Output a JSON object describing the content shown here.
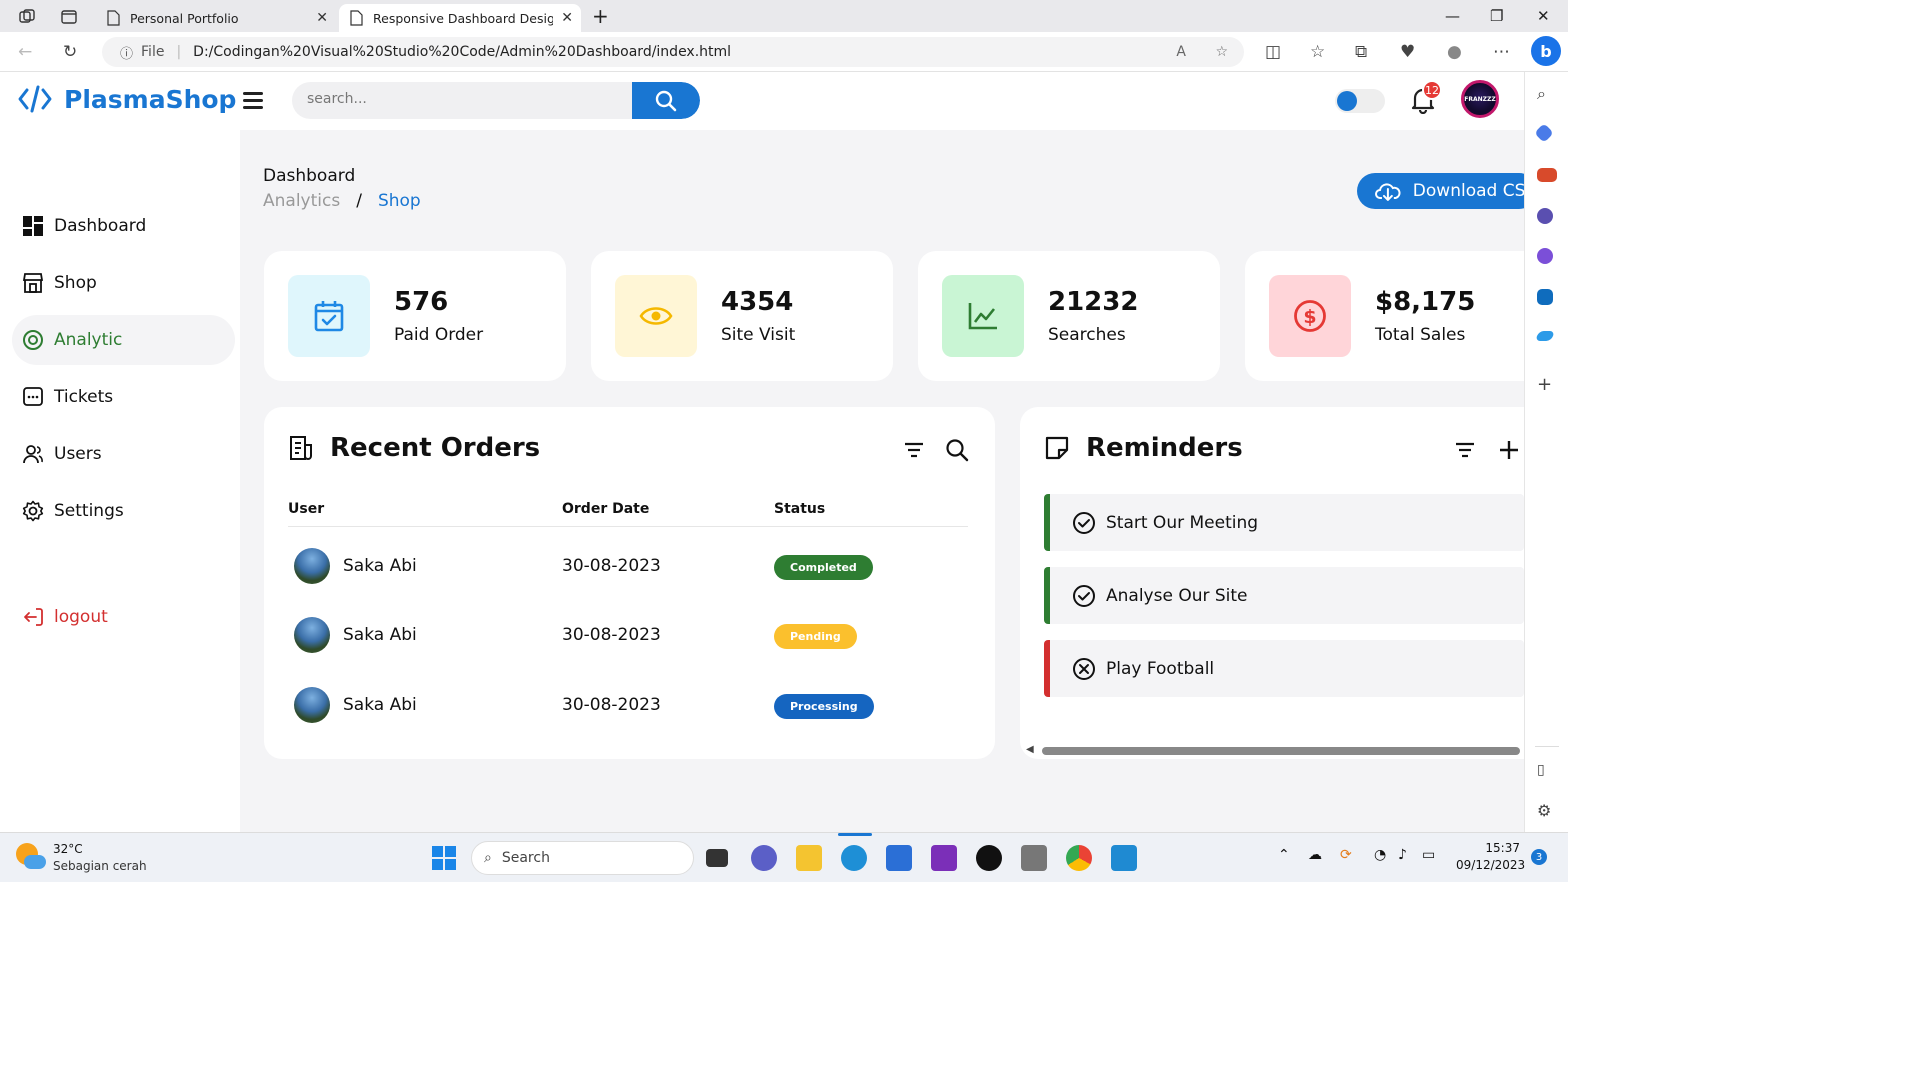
{
  "browser": {
    "tabs": [
      {
        "title": "Personal Portfolio"
      },
      {
        "title": "Responsive Dashboard Design By"
      }
    ],
    "address_prefix": "File",
    "address": "D:/Codingan%20Visual%20Studio%20Code/Admin%20Dashboard/index.html"
  },
  "app": {
    "brand": "PlasmaShop",
    "search_placeholder": "search...",
    "notifications_count": "12",
    "avatar_text": "FRANZZZ"
  },
  "sidebar": {
    "items": [
      {
        "label": "Dashboard"
      },
      {
        "label": "Shop"
      },
      {
        "label": "Analytic"
      },
      {
        "label": "Tickets"
      },
      {
        "label": "Users"
      },
      {
        "label": "Settings"
      }
    ],
    "logout_label": "logout"
  },
  "main": {
    "title": "Dashboard",
    "breadcrumb": {
      "first": "Analytics",
      "sep": "/",
      "current": "Shop"
    },
    "download_label": "Download CSV",
    "cards": [
      {
        "value": "576",
        "label": "Paid Order",
        "color": "#dff6fc",
        "icon_color": "#1e88e5"
      },
      {
        "value": "4354",
        "label": "Site Visit",
        "color": "#fff6d6",
        "icon_color": "#f5b800"
      },
      {
        "value": "21232",
        "label": "Searches",
        "color": "#c9f5d4",
        "icon_color": "#2e7d32"
      },
      {
        "value": "$8,175",
        "label": "Total Sales",
        "color": "#ffd5d9",
        "icon_color": "#e53935"
      }
    ]
  },
  "orders": {
    "title": "Recent Orders",
    "columns": {
      "user": "User",
      "date": "Order Date",
      "status": "Status"
    },
    "rows": [
      {
        "user": "Saka Abi",
        "date": "30-08-2023",
        "status": "Completed",
        "color": "#2e7d32"
      },
      {
        "user": "Saka Abi",
        "date": "30-08-2023",
        "status": "Pending",
        "color": "#fbc02d"
      },
      {
        "user": "Saka Abi",
        "date": "30-08-2023",
        "status": "Processing",
        "color": "#1565c0"
      }
    ]
  },
  "reminders": {
    "title": "Reminders",
    "items": [
      {
        "label": "Start Our Meeting",
        "state": "done",
        "color": "#2e7d32"
      },
      {
        "label": "Analyse Our Site",
        "state": "done",
        "color": "#2e7d32"
      },
      {
        "label": "Play Football",
        "state": "not-done",
        "color": "#d32f2f"
      }
    ]
  },
  "taskbar": {
    "weather_temp": "32°C",
    "weather_text": "Sebagian cerah",
    "search_label": "Search",
    "time": "15:37",
    "date": "09/12/2023",
    "notif_count": "3"
  }
}
